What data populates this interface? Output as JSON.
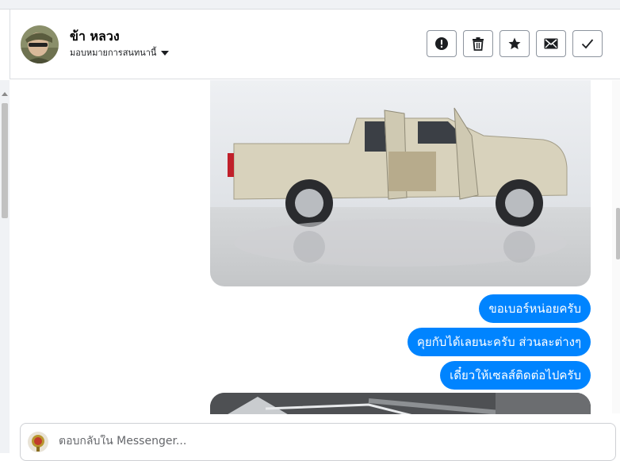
{
  "contact": {
    "name": "ข้า หลวง",
    "assign_label": "มอบหมายการสนทนานี้"
  },
  "actions": [
    {
      "icon": "alert-icon",
      "name": "mark-spam-button"
    },
    {
      "icon": "trash-icon",
      "name": "delete-button"
    },
    {
      "icon": "star-icon",
      "name": "star-button"
    },
    {
      "icon": "envelope-icon",
      "name": "mark-unread-button"
    },
    {
      "icon": "check-icon",
      "name": "mark-done-button"
    }
  ],
  "messages": [
    {
      "text": "ขอเบอร์หน่อยครับ"
    },
    {
      "text": "คุยกับได้เลยนะครับ  ส่วนละต่างๆ"
    },
    {
      "text": "เดี๋ยวให้เซลส์ติดต่อไปครับ"
    }
  ],
  "composer": {
    "placeholder": "ตอบกลับใน Messenger..."
  },
  "colors": {
    "bubble": "#0084ff",
    "border": "#dadde1"
  }
}
